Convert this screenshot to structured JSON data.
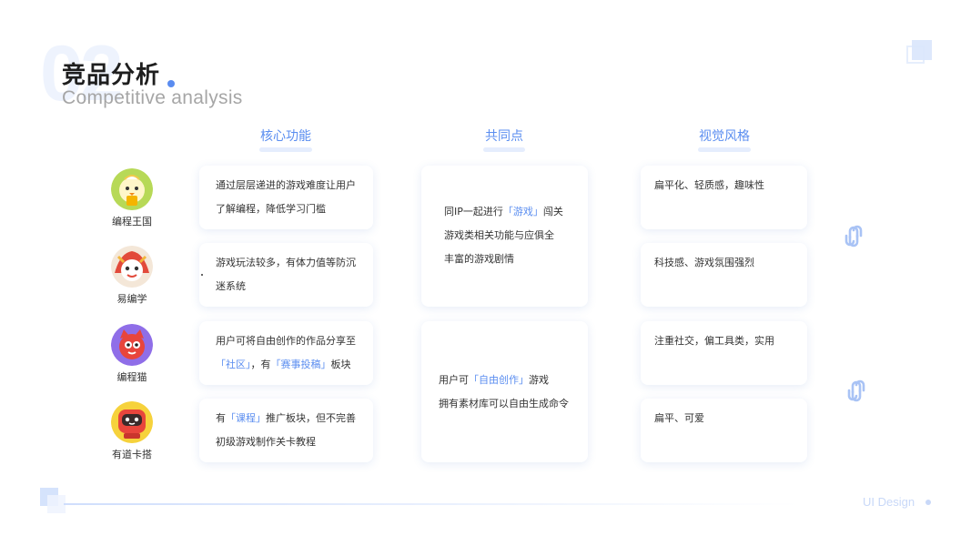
{
  "header": {
    "number": "02",
    "title": "竞品分析",
    "subtitle": "Competitive analysis"
  },
  "columns": {
    "core": "核心功能",
    "common": "共同点",
    "visual": "视觉风格"
  },
  "apps": [
    {
      "name": "编程王国",
      "icon": "chick-icon"
    },
    {
      "name": "易编学",
      "icon": "character-icon"
    },
    {
      "name": "编程猫",
      "icon": "cat-icon"
    },
    {
      "name": "有道卡搭",
      "icon": "robot-icon"
    }
  ],
  "core": {
    "c0": {
      "line1": "通过层层递进的游戏难度让用户",
      "line2": "了解编程，降低学习门槛"
    },
    "c1": {
      "line1": "游戏玩法较多，有体力值等防沉",
      "line2": "迷系统"
    },
    "c2": {
      "l1": "用户可将自由创作的作品分享至",
      "q1": "「社区」",
      "mid": "，有",
      "q2": "「赛事投稿」",
      "tail": "板块"
    },
    "c3": {
      "a": "有",
      "q": "「课程」",
      "b": "推广板块，但不完善",
      "line2": "初级游戏制作关卡教程"
    }
  },
  "common": {
    "g0": {
      "a": "同IP一起进行",
      "q": "「游戏」",
      "b": "闯关",
      "line2": "游戏类相关功能与应俱全",
      "line3": "丰富的游戏剧情"
    },
    "g1": {
      "a": "用户可",
      "q": "「自由创作」",
      "b": "游戏",
      "line2": "拥有素材库可以自由生成命令"
    }
  },
  "visual": [
    "扁平化、轻质感，趣味性",
    "科技感、游戏氛围强烈",
    "注重社交，偏工具类，实用",
    "扁平、可爱"
  ],
  "footer": {
    "label": "UI Design"
  },
  "colors": {
    "accent": "#5b8ef0",
    "light": "#e5edfd"
  }
}
